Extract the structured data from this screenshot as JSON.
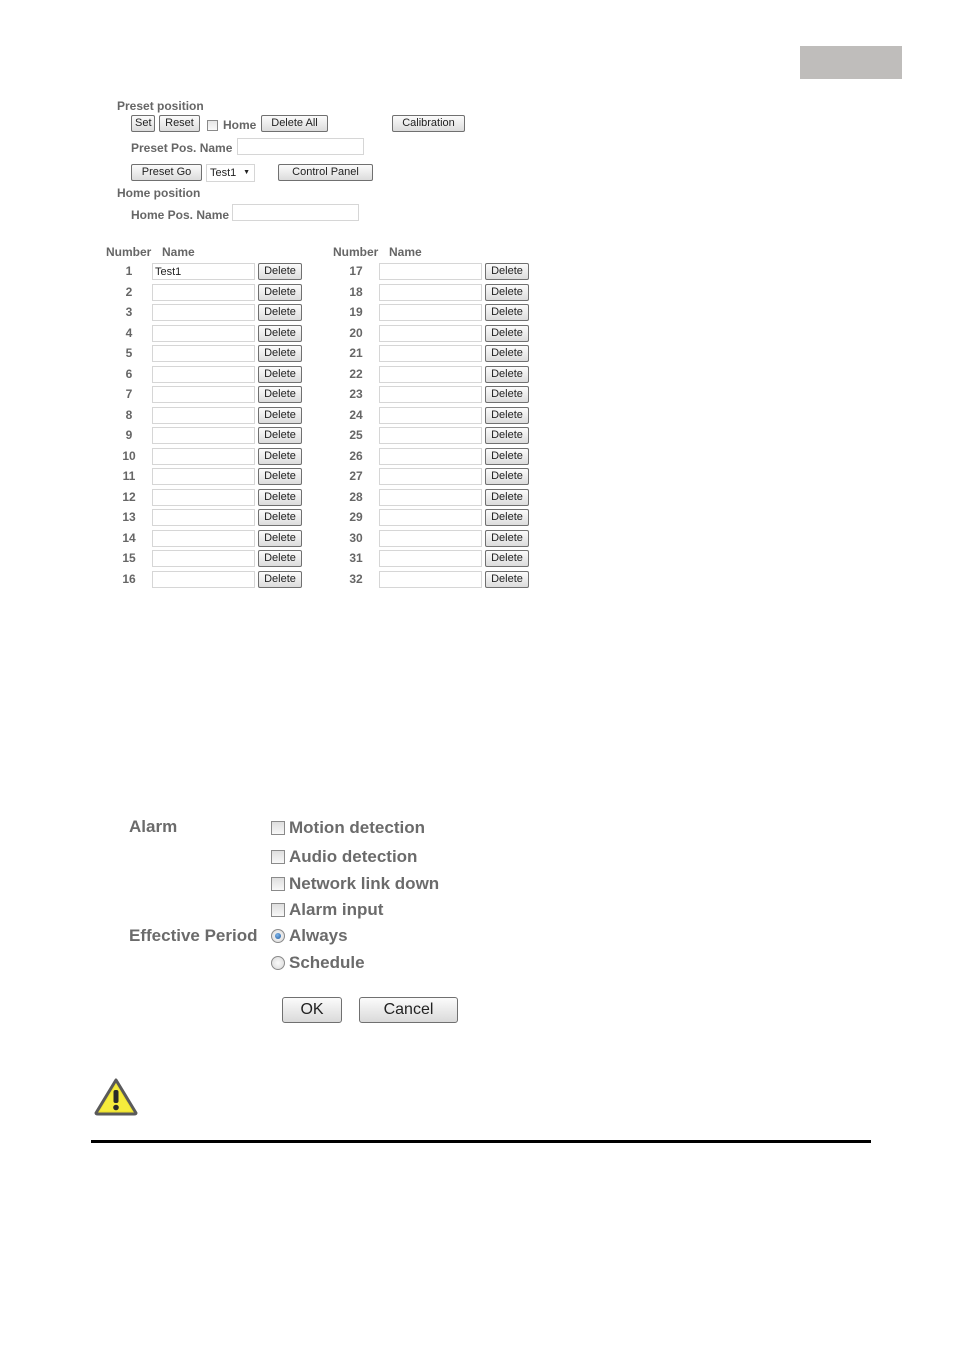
{
  "preset": {
    "section_title": "Preset position",
    "set_label": "Set",
    "reset_label": "Reset",
    "home_checkbox_label": "Home",
    "home_checked": false,
    "delete_all_label": "Delete All",
    "calibration_label": "Calibration",
    "preset_pos_name_label": "Preset Pos. Name",
    "preset_pos_name_value": "",
    "preset_go_label": "Preset Go",
    "preset_select_value": "Test1",
    "control_panel_label": "Control Panel"
  },
  "home": {
    "section_title": "Home position",
    "home_pos_name_label": "Home Pos. Name",
    "home_pos_name_value": ""
  },
  "presets_table": {
    "number_header": "Number",
    "name_header": "Name",
    "delete_label": "Delete",
    "rows": [
      {
        "number": "1",
        "name": "Test1"
      },
      {
        "number": "2",
        "name": ""
      },
      {
        "number": "3",
        "name": ""
      },
      {
        "number": "4",
        "name": ""
      },
      {
        "number": "5",
        "name": ""
      },
      {
        "number": "6",
        "name": ""
      },
      {
        "number": "7",
        "name": ""
      },
      {
        "number": "8",
        "name": ""
      },
      {
        "number": "9",
        "name": ""
      },
      {
        "number": "10",
        "name": ""
      },
      {
        "number": "11",
        "name": ""
      },
      {
        "number": "12",
        "name": ""
      },
      {
        "number": "13",
        "name": ""
      },
      {
        "number": "14",
        "name": ""
      },
      {
        "number": "15",
        "name": ""
      },
      {
        "number": "16",
        "name": ""
      },
      {
        "number": "17",
        "name": ""
      },
      {
        "number": "18",
        "name": ""
      },
      {
        "number": "19",
        "name": ""
      },
      {
        "number": "20",
        "name": ""
      },
      {
        "number": "21",
        "name": ""
      },
      {
        "number": "22",
        "name": ""
      },
      {
        "number": "23",
        "name": ""
      },
      {
        "number": "24",
        "name": ""
      },
      {
        "number": "25",
        "name": ""
      },
      {
        "number": "26",
        "name": ""
      },
      {
        "number": "27",
        "name": ""
      },
      {
        "number": "28",
        "name": ""
      },
      {
        "number": "29",
        "name": ""
      },
      {
        "number": "30",
        "name": ""
      },
      {
        "number": "31",
        "name": ""
      },
      {
        "number": "32",
        "name": ""
      }
    ]
  },
  "alarm": {
    "alarm_label": "Alarm",
    "options": [
      {
        "label": "Motion detection",
        "checked": false
      },
      {
        "label": "Audio detection",
        "checked": false
      },
      {
        "label": "Network link down",
        "checked": false
      },
      {
        "label": "Alarm input",
        "checked": false
      }
    ],
    "effective_period_label": "Effective Period",
    "period_options": [
      {
        "label": "Always",
        "selected": true
      },
      {
        "label": "Schedule",
        "selected": false
      }
    ],
    "ok_label": "OK",
    "cancel_label": "Cancel"
  },
  "warning": {
    "icon": "warning-triangle-icon"
  }
}
